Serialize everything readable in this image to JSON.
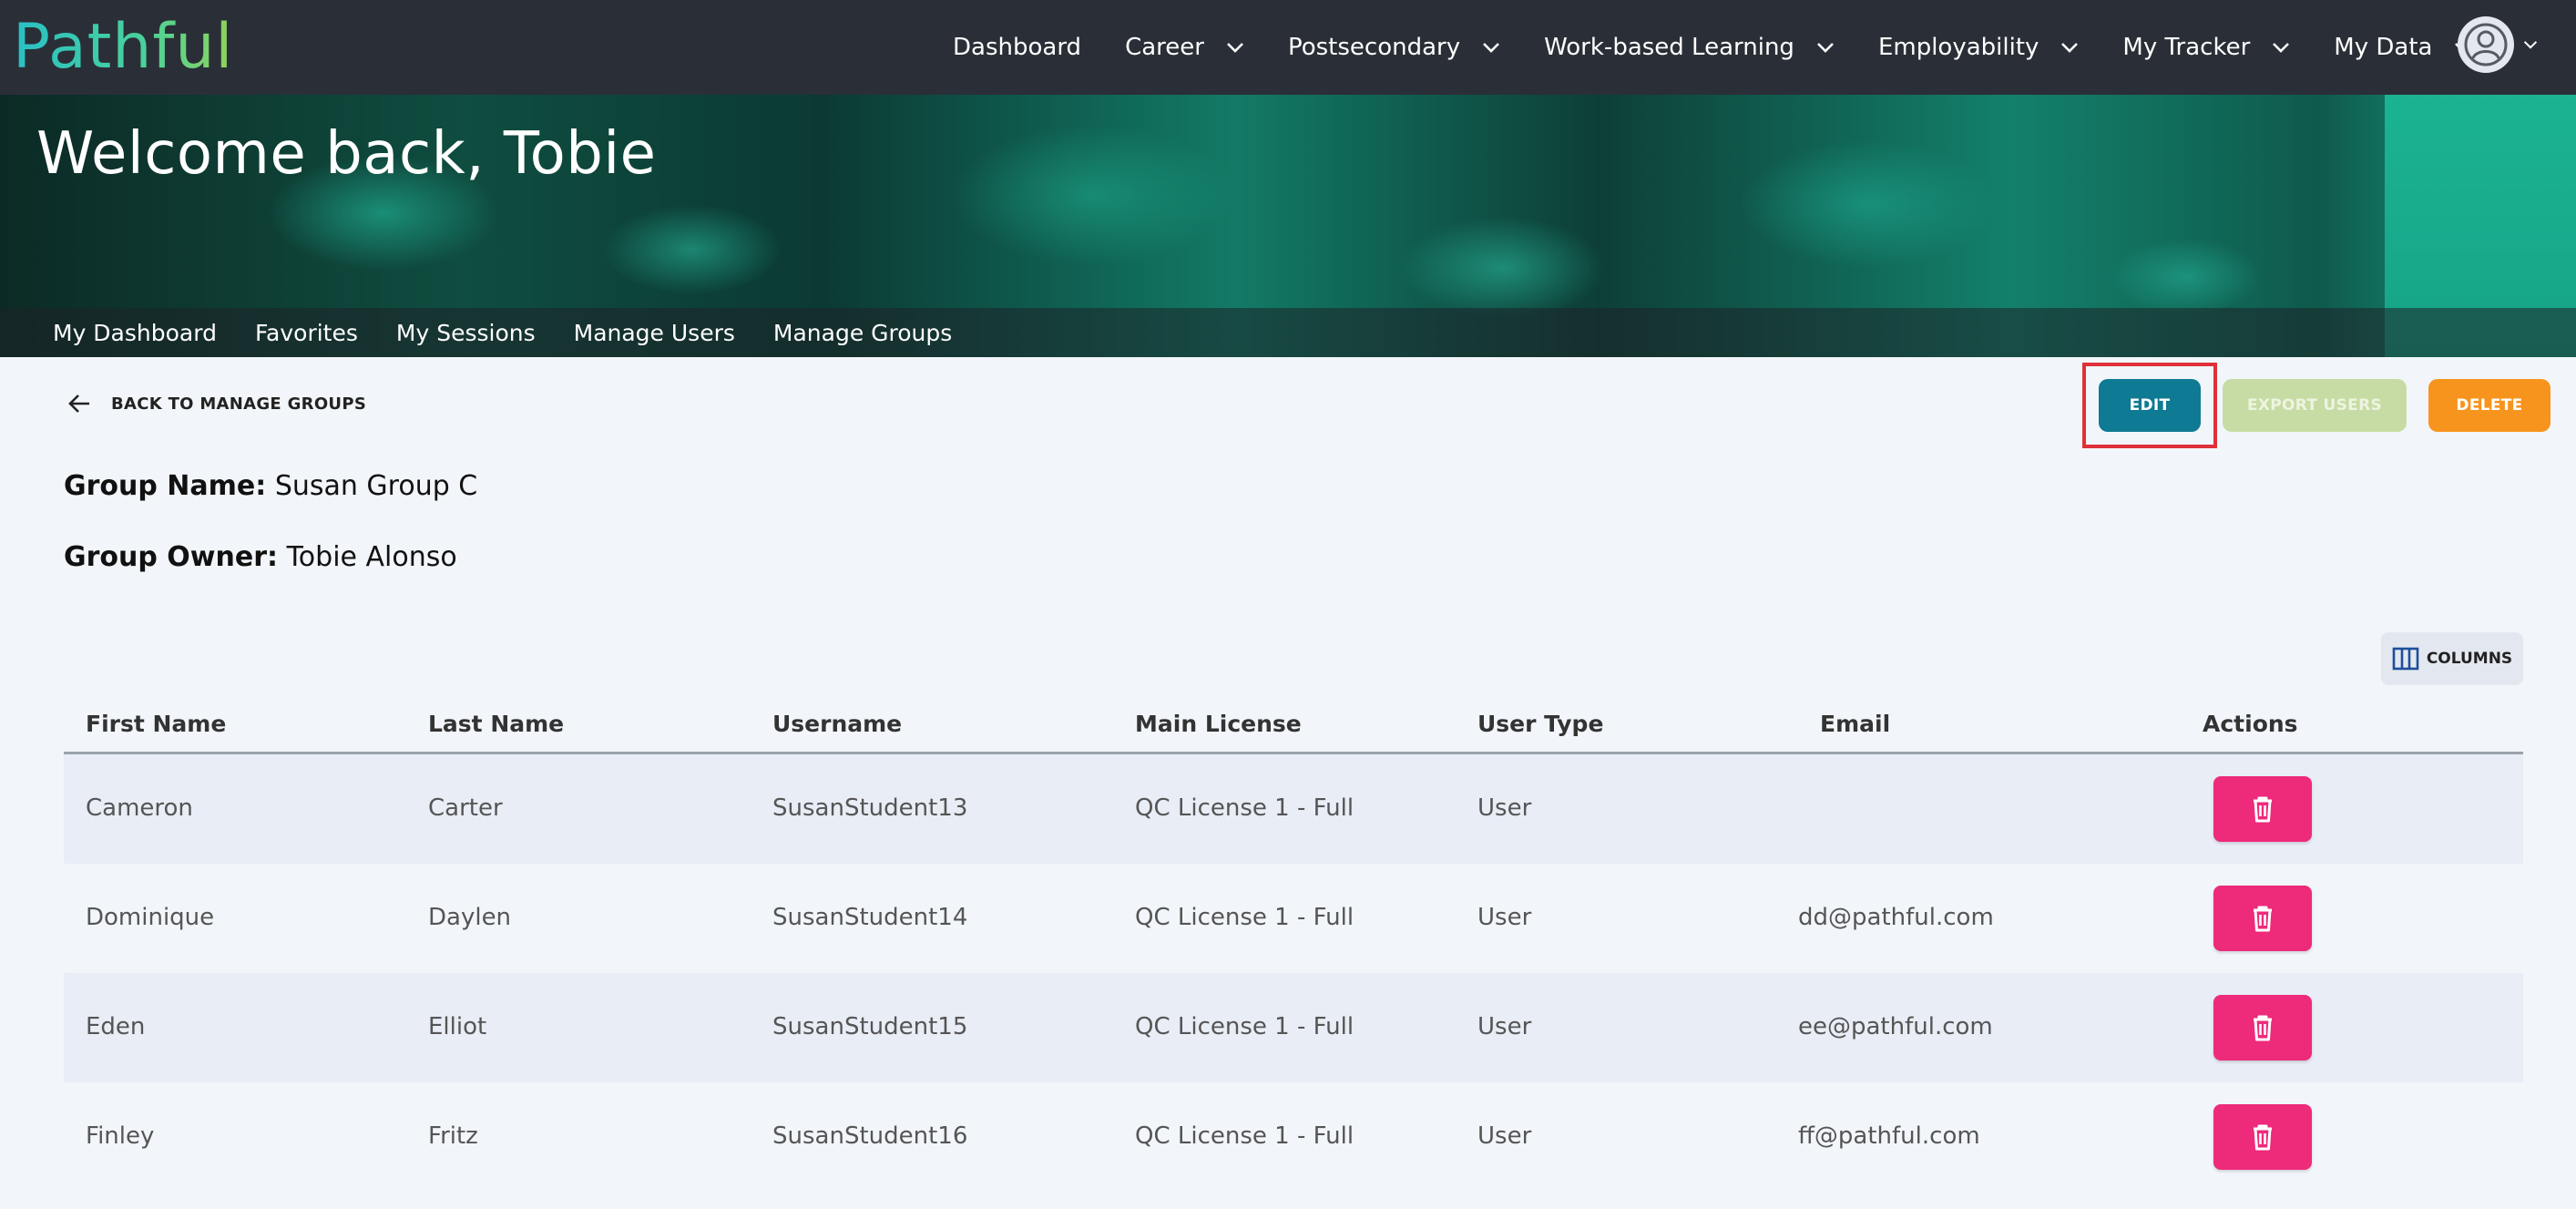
{
  "brand": {
    "logo_text": "Pathful"
  },
  "topnav": {
    "items": [
      {
        "label": "Dashboard",
        "dropdown": false
      },
      {
        "label": "Career",
        "dropdown": true
      },
      {
        "label": "Postsecondary",
        "dropdown": true
      },
      {
        "label": "Work-based Learning",
        "dropdown": true
      },
      {
        "label": "Employability",
        "dropdown": true
      },
      {
        "label": "My Tracker",
        "dropdown": true
      },
      {
        "label": "My Data",
        "dropdown": true
      }
    ],
    "account_icon": "user-avatar-icon"
  },
  "hero": {
    "title": "Welcome back, Tobie"
  },
  "subnav": {
    "items": [
      "My Dashboard",
      "Favorites",
      "My Sessions",
      "Manage Users",
      "Manage Groups"
    ]
  },
  "back_link": {
    "label": "BACK TO MANAGE GROUPS"
  },
  "actions": {
    "edit": "EDIT",
    "export": "EXPORT USERS",
    "delete": "DELETE"
  },
  "group": {
    "name_label": "Group Name:",
    "name_value": "Susan Group C",
    "owner_label": "Group Owner:",
    "owner_value": "Tobie Alonso"
  },
  "columns_button": {
    "label": "COLUMNS"
  },
  "table": {
    "headers": [
      "First Name",
      "Last Name",
      "Username",
      "Main License",
      "User Type",
      "Email",
      "Actions"
    ],
    "rows": [
      {
        "first": "Cameron",
        "last": "Carter",
        "username": "SusanStudent13",
        "license": "QC License 1 - Full",
        "type": "User",
        "email": ""
      },
      {
        "first": "Dominique",
        "last": "Daylen",
        "username": "SusanStudent14",
        "license": "QC License 1 - Full",
        "type": "User",
        "email": "dd@pathful.com"
      },
      {
        "first": "Eden",
        "last": "Elliot",
        "username": "SusanStudent15",
        "license": "QC License 1 - Full",
        "type": "User",
        "email": "ee@pathful.com"
      },
      {
        "first": "Finley",
        "last": "Fritz",
        "username": "SusanStudent16",
        "license": "QC License 1 - Full",
        "type": "User",
        "email": "ff@pathful.com"
      }
    ]
  },
  "colors": {
    "navbar": "#2a2f37",
    "edit": "#0f7a93",
    "export": "#c7dca4",
    "delete": "#f7941d",
    "trash": "#ee2a7b",
    "highlight": "#e0303a"
  }
}
